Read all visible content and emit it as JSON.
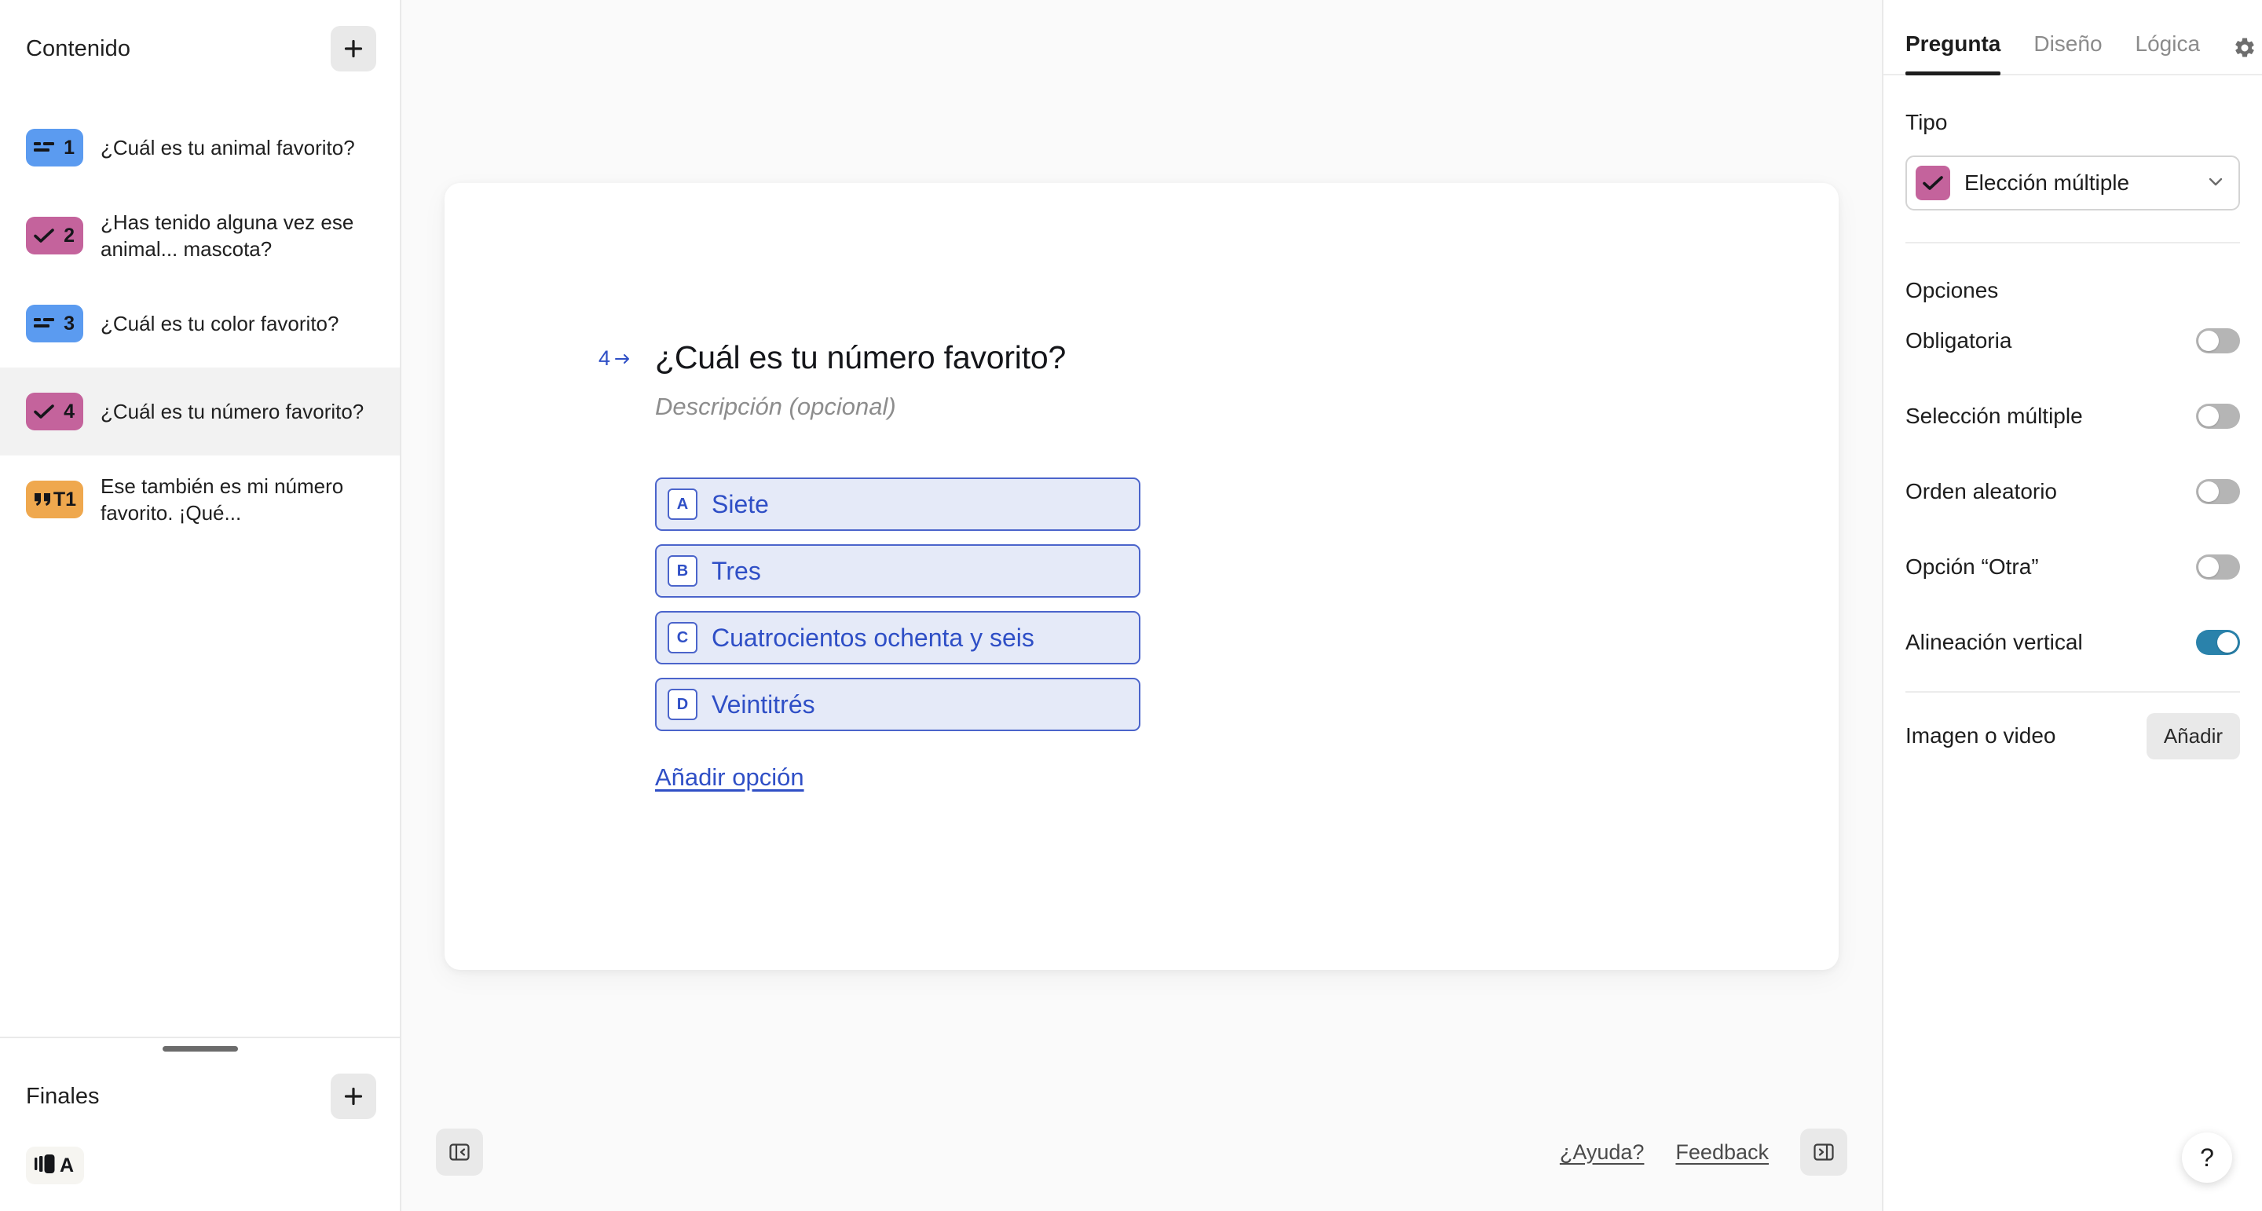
{
  "sidebar": {
    "content_title": "Contenido",
    "add_content_label": "+",
    "questions": [
      {
        "num": "1",
        "icon": "short-text-icon",
        "color": "#5b9bf0",
        "label": "¿Cuál es tu animal favorito?",
        "active": false
      },
      {
        "num": "2",
        "icon": "multiple-choice-icon",
        "color": "#c4639c",
        "label": "¿Has tenido alguna vez ese animal... mascota?",
        "active": false
      },
      {
        "num": "3",
        "icon": "short-text-icon",
        "color": "#5b9bf0",
        "label": "¿Cuál es tu color favorito?",
        "active": false
      },
      {
        "num": "4",
        "icon": "multiple-choice-icon",
        "color": "#c4639c",
        "label": "¿Cuál es tu número favorito?",
        "active": true
      },
      {
        "num": "T1",
        "icon": "statement-icon",
        "color": "#efa84e",
        "label": "Ese también es mi número favorito. ¡Qué...",
        "active": false
      }
    ],
    "endings_title": "Finales",
    "add_ending_label": "+",
    "endings": [
      {
        "icon": "ending-card-icon",
        "label": "A"
      }
    ]
  },
  "canvas": {
    "question_index": "4",
    "question_title": "¿Cuál es tu número favorito?",
    "description_placeholder": "Descripción (opcional)",
    "choices": [
      {
        "key": "A",
        "text": "Siete"
      },
      {
        "key": "B",
        "text": "Tres"
      },
      {
        "key": "C",
        "text": "Cuatrocientos ochenta y seis"
      },
      {
        "key": "D",
        "text": "Veintitrés"
      }
    ],
    "add_option_label": "Añadir opción",
    "choice_fill": "#e5eaf8",
    "choice_border": "#4b64cb",
    "choice_text_color": "#2f4fc6"
  },
  "bottom_bar": {
    "collapse_left_label": "collapse-left-panel",
    "collapse_right_label": "collapse-right-panel",
    "help_link": "¿Ayuda?",
    "feedback_link": "Feedback"
  },
  "right_panel": {
    "tabs": [
      {
        "label": "Pregunta",
        "active": true
      },
      {
        "label": "Diseño",
        "active": false
      },
      {
        "label": "Lógica",
        "active": false
      }
    ],
    "settings_icon": "gear-icon",
    "type_section_title": "Tipo",
    "type_value": "Elección múltiple",
    "type_icon_color": "#c4639c",
    "options_section_title": "Opciones",
    "options": [
      {
        "label": "Obligatoria",
        "on": false
      },
      {
        "label": "Selección múltiple",
        "on": false
      },
      {
        "label": "Orden aleatorio",
        "on": false
      },
      {
        "label": "Opción “Otra”",
        "on": false
      },
      {
        "label": "Alineación vertical",
        "on": true
      }
    ],
    "media_label": "Imagen o video",
    "media_button": "Añadir",
    "toggle_on_color": "#2a82ab",
    "toggle_off_color": "#b5b5b5",
    "help_fab": "?"
  }
}
